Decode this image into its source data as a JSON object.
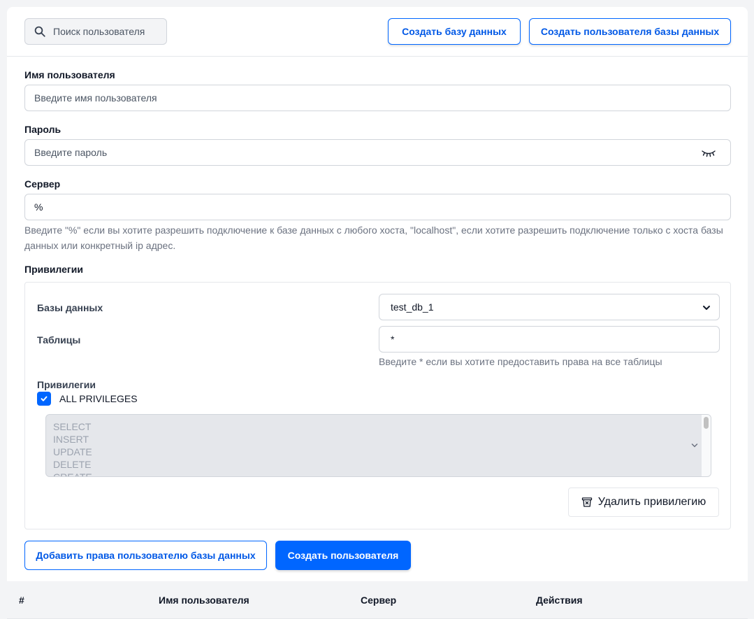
{
  "topbar": {
    "search_placeholder": "Поиск пользователя",
    "create_db_label": "Создать базу данных",
    "create_db_user_label": "Создать пользователя базы данных"
  },
  "form": {
    "username": {
      "label": "Имя пользователя",
      "placeholder": "Введите имя пользователя",
      "value": ""
    },
    "password": {
      "label": "Пароль",
      "placeholder": "Введите пароль",
      "value": ""
    },
    "server": {
      "label": "Сервер",
      "value": "%",
      "hint": "Введите \"%\" если вы хотите разрешить подключение к базе данных с любого хоста, \"localhost\", если хотите разрешить подключение только с хоста базы данных или конкретный ip адрес."
    }
  },
  "privileges": {
    "section_label": "Привилегии",
    "databases_label": "Базы данных",
    "database_selected": "test_db_1",
    "tables_label": "Таблицы",
    "tables_value": "*",
    "tables_hint": "Введите * если вы хотите предоставить права на все таблицы",
    "privileges_label": "Привилегии",
    "all_privileges_label": "ALL PRIVILEGES",
    "all_privileges_checked": true,
    "options": [
      "SELECT",
      "INSERT",
      "UPDATE",
      "DELETE",
      "CREATE"
    ],
    "delete_button_label": "Удалить привилегию"
  },
  "actions": {
    "add_rights_label": "Добавить права пользователю базы данных",
    "create_user_label": "Создать пользователя"
  },
  "table": {
    "columns": [
      "#",
      "Имя пользователя",
      "Сервер",
      "Действия"
    ]
  },
  "colors": {
    "accent": "#0066ff",
    "background": "#f3f4f6"
  }
}
